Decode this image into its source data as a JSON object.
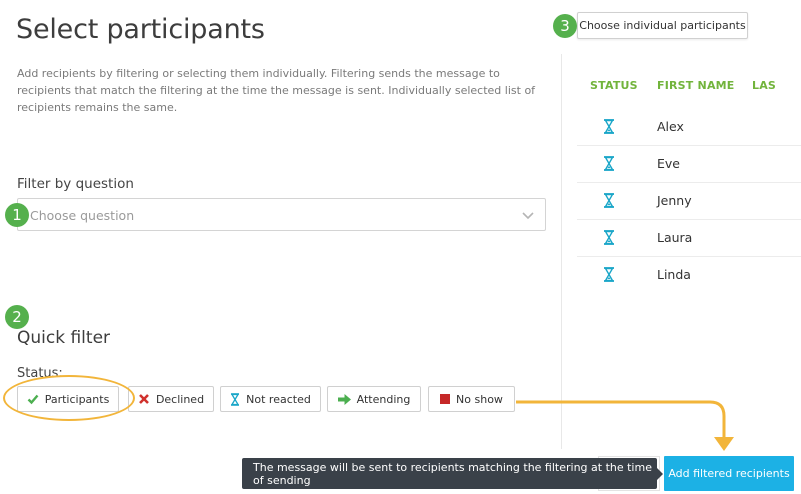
{
  "header": {
    "title": "Select participants",
    "description": "Add recipients by filtering or selecting them individually. Filtering sends the message to recipients that match the filtering at the time the message is sent. Individually selected list of recipients remains the same."
  },
  "filter": {
    "label": "Filter by question",
    "placeholder": "Choose question"
  },
  "steps": {
    "one": "1",
    "two": "2",
    "three": "3"
  },
  "quick_filter": {
    "title": "Quick filter",
    "status_label": "Status:",
    "buttons": [
      {
        "label": "Participants",
        "icon": "check-icon",
        "color": "#4caf50"
      },
      {
        "label": "Declined",
        "icon": "x-icon",
        "color": "#d0312d"
      },
      {
        "label": "Not reacted",
        "icon": "hourglass-icon",
        "color": "#1aa6c8"
      },
      {
        "label": "Attending",
        "icon": "arrow-right-icon",
        "color": "#4caf50"
      },
      {
        "label": "No show",
        "icon": "square-icon",
        "color": "#c62828"
      }
    ]
  },
  "individual": {
    "choose_button": "Choose individual participants",
    "columns": [
      "STATUS",
      "FIRST NAME",
      "LAS"
    ],
    "rows": [
      {
        "status_icon": "hourglass-icon",
        "first_name": "Alex"
      },
      {
        "status_icon": "hourglass-icon",
        "first_name": "Eve"
      },
      {
        "status_icon": "hourglass-icon",
        "first_name": "Jenny"
      },
      {
        "status_icon": "hourglass-icon",
        "first_name": "Laura"
      },
      {
        "status_icon": "hourglass-icon",
        "first_name": "Linda"
      }
    ]
  },
  "footer": {
    "tooltip": "The message will be sent to recipients matching the filtering at the time of sending",
    "add_button": "Add filtered recipients"
  },
  "colors": {
    "accent_green": "#72b43c",
    "badge_green": "#55b04d",
    "highlight_orange": "#f2b53a",
    "primary_blue": "#1cb1e5",
    "tooltip_bg": "#3a4149"
  }
}
